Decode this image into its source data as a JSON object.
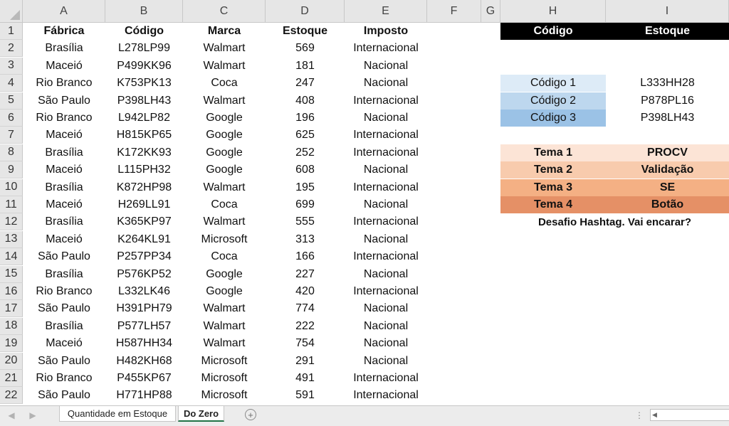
{
  "columns": [
    "A",
    "B",
    "C",
    "D",
    "E",
    "F",
    "G",
    "H",
    "I"
  ],
  "row_numbers": [
    "1",
    "2",
    "3",
    "4",
    "5",
    "6",
    "7",
    "8",
    "9",
    "10",
    "11",
    "12",
    "13",
    "14",
    "15",
    "16",
    "17",
    "18",
    "19",
    "20",
    "21",
    "22"
  ],
  "table": {
    "headers": [
      "Fábrica",
      "Código",
      "Marca",
      "Estoque",
      "Imposto"
    ],
    "rows": [
      [
        "Brasília",
        "L278LP99",
        "Walmart",
        "569",
        "Internacional"
      ],
      [
        "Maceió",
        "P499KK96",
        "Walmart",
        "181",
        "Nacional"
      ],
      [
        "Rio Branco",
        "K753PK13",
        "Coca",
        "247",
        "Nacional"
      ],
      [
        "São Paulo",
        "P398LH43",
        "Walmart",
        "408",
        "Internacional"
      ],
      [
        "Rio Branco",
        "L942LP82",
        "Google",
        "196",
        "Nacional"
      ],
      [
        "Maceió",
        "H815KP65",
        "Google",
        "625",
        "Internacional"
      ],
      [
        "Brasília",
        "K172KK93",
        "Google",
        "252",
        "Internacional"
      ],
      [
        "Maceió",
        "L115PH32",
        "Google",
        "608",
        "Nacional"
      ],
      [
        "Brasília",
        "K872HP98",
        "Walmart",
        "195",
        "Internacional"
      ],
      [
        "Maceió",
        "H269LL91",
        "Coca",
        "699",
        "Nacional"
      ],
      [
        "Brasília",
        "K365KP97",
        "Walmart",
        "555",
        "Internacional"
      ],
      [
        "Maceió",
        "K264KL91",
        "Microsoft",
        "313",
        "Nacional"
      ],
      [
        "São Paulo",
        "P257PP34",
        "Coca",
        "166",
        "Internacional"
      ],
      [
        "Brasília",
        "P576KP52",
        "Google",
        "227",
        "Nacional"
      ],
      [
        "Rio Branco",
        "L332LK46",
        "Google",
        "420",
        "Internacional"
      ],
      [
        "São Paulo",
        "H391PH79",
        "Walmart",
        "774",
        "Nacional"
      ],
      [
        "Brasília",
        "P577LH57",
        "Walmart",
        "222",
        "Nacional"
      ],
      [
        "Maceió",
        "H587HH34",
        "Walmart",
        "754",
        "Nacional"
      ],
      [
        "São Paulo",
        "H482KH68",
        "Microsoft",
        "291",
        "Nacional"
      ],
      [
        "Rio Branco",
        "P455KP67",
        "Microsoft",
        "491",
        "Internacional"
      ],
      [
        "São Paulo",
        "H771HP88",
        "Microsoft",
        "591",
        "Internacional"
      ]
    ]
  },
  "lookup": {
    "header_codigo": "Código",
    "header_estoque": "Estoque",
    "header_bg": "#000000",
    "items": [
      {
        "label": "Código 1",
        "value": "L333HH28",
        "color": "#ddebf7"
      },
      {
        "label": "Código 2",
        "value": "P878PL16",
        "color": "#bdd7ee"
      },
      {
        "label": "Código 3",
        "value": "P398LH43",
        "color": "#9bc2e6"
      }
    ]
  },
  "temas": {
    "items": [
      {
        "label": "Tema 1",
        "value": "PROCV",
        "color": "#fce4d6"
      },
      {
        "label": "Tema 2",
        "value": "Validação",
        "color": "#f8cbad"
      },
      {
        "label": "Tema 3",
        "value": "SE",
        "color": "#f4b084"
      },
      {
        "label": "Tema 4",
        "value": "Botão",
        "color": "#e59066"
      }
    ],
    "caption": "Desafio Hashtag. Vai encarar?"
  },
  "sheet_tabs": [
    {
      "label": "Quantidade em Estoque",
      "active": false
    },
    {
      "label": "Do Zero",
      "active": true
    }
  ],
  "add_sheet_icon": "plus-circle-icon",
  "accent_color": "#217346"
}
